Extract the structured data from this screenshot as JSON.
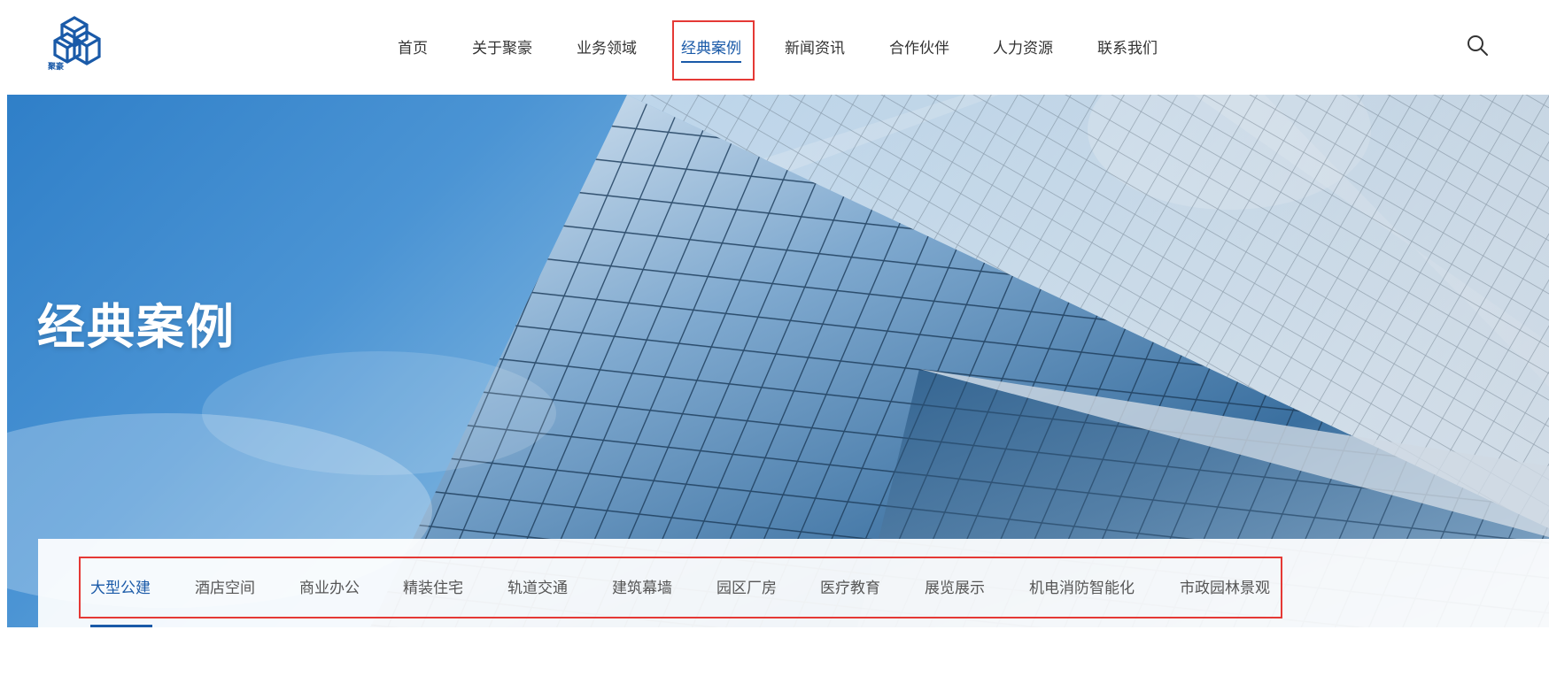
{
  "logo": {
    "text": "聚豪",
    "icon": "cube-logo"
  },
  "nav": {
    "items": [
      {
        "label": "首页"
      },
      {
        "label": "关于聚豪"
      },
      {
        "label": "业务领域"
      },
      {
        "label": "经典案例",
        "active": true
      },
      {
        "label": "新闻资讯"
      },
      {
        "label": "合作伙伴"
      },
      {
        "label": "人力资源"
      },
      {
        "label": "联系我们"
      }
    ],
    "search_icon": "search-icon"
  },
  "banner": {
    "title": "经典案例"
  },
  "categories": {
    "items": [
      {
        "label": "大型公建",
        "active": true
      },
      {
        "label": "酒店空间"
      },
      {
        "label": "商业办公"
      },
      {
        "label": "精装住宅"
      },
      {
        "label": "轨道交通"
      },
      {
        "label": "建筑幕墙"
      },
      {
        "label": "园区厂房"
      },
      {
        "label": "医疗教育"
      },
      {
        "label": "展览展示"
      },
      {
        "label": "机电消防智能化"
      },
      {
        "label": "市政园林景观"
      }
    ]
  },
  "colors": {
    "accent": "#1a5aa8",
    "highlight_box": "#e53935",
    "text": "#333333"
  }
}
